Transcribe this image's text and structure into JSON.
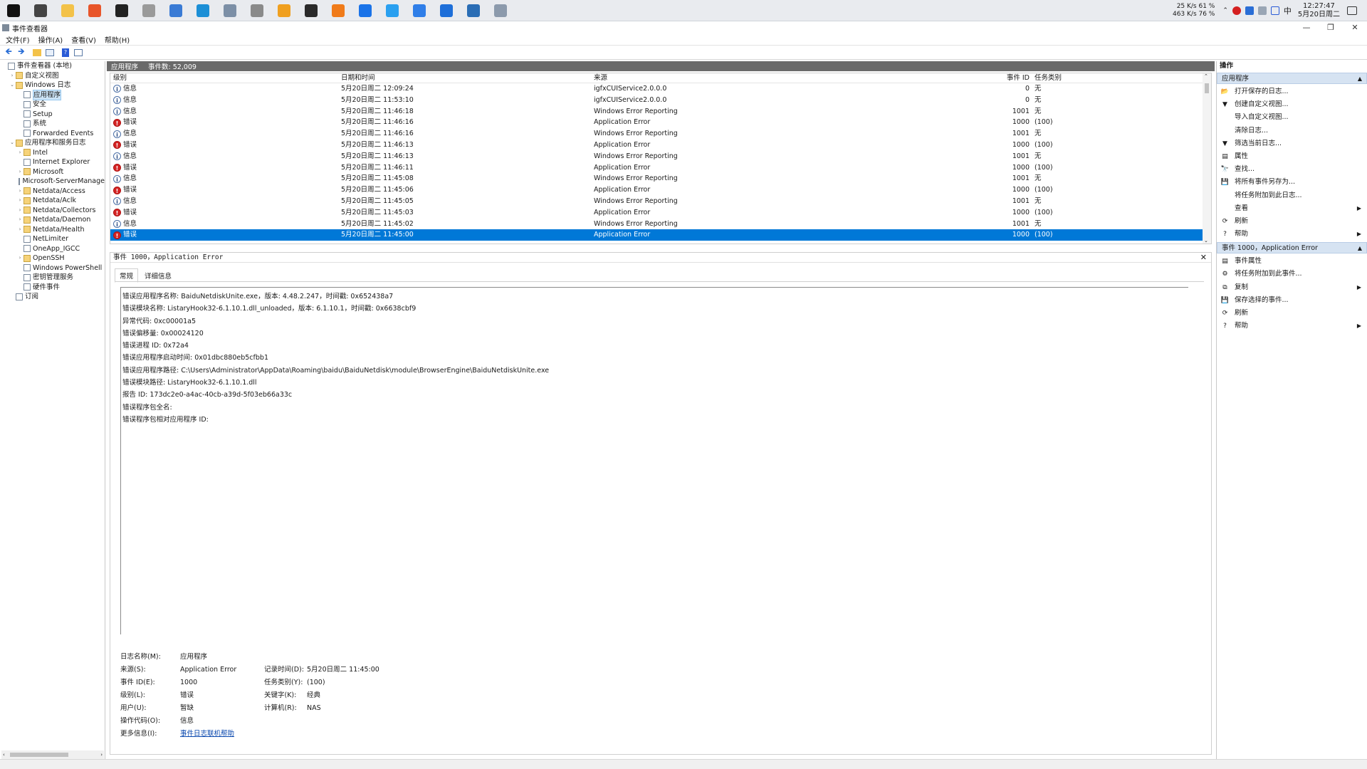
{
  "taskbar": {
    "apps": [
      {
        "name": "windows-start-icon",
        "color": "#111111"
      },
      {
        "name": "task-view-icon",
        "color": "#444444"
      },
      {
        "name": "file-explorer-icon",
        "color": "#f3c249"
      },
      {
        "name": "firefox-icon",
        "color": "#e8552a"
      },
      {
        "name": "terminal-icon",
        "color": "#222222"
      },
      {
        "name": "clock-app-icon",
        "color": "#9a9a9a"
      },
      {
        "name": "search-app-icon",
        "color": "#3a7bd5"
      },
      {
        "name": "store-icon",
        "color": "#1c8fd6"
      },
      {
        "name": "remote-desktop-icon",
        "color": "#7c8fa6"
      },
      {
        "name": "disk-icon",
        "color": "#8a8a8a"
      },
      {
        "name": "magnifier-icon",
        "color": "#f0a020"
      },
      {
        "name": "black-app-icon",
        "color": "#2a2a2a"
      },
      {
        "name": "orange-app-icon",
        "color": "#f07b1a"
      },
      {
        "name": "blue-circle-icon",
        "color": "#1a73e8"
      },
      {
        "name": "cloud-app-icon",
        "color": "#2aa0f0"
      },
      {
        "name": "telegram-like-icon",
        "color": "#2f7ee8"
      },
      {
        "name": "window-app-icon",
        "color": "#1e6fd9"
      },
      {
        "name": "network-app-icon",
        "color": "#2a6db5"
      },
      {
        "name": "event-viewer-taskbar-icon",
        "color": "#8c9aac"
      }
    ],
    "net_up": "25 K/s  61 %",
    "net_down": "463 K/s  76 %",
    "ime": "中",
    "time": "12:27:47",
    "date": "5月20日周二"
  },
  "window": {
    "title": "事件查看器",
    "controls": [
      "—",
      "❐",
      "✕"
    ]
  },
  "menu": [
    "文件(F)",
    "操作(A)",
    "查看(V)",
    "帮助(H)"
  ],
  "tree": [
    {
      "label": "事件查看器 (本地)",
      "depth": 0,
      "exp": "",
      "ic": "log"
    },
    {
      "label": "自定义视图",
      "depth": 1,
      "exp": "›",
      "ic": "folder"
    },
    {
      "label": "Windows 日志",
      "depth": 1,
      "exp": "⌄",
      "ic": "folder"
    },
    {
      "label": "应用程序",
      "depth": 2,
      "exp": "",
      "ic": "log",
      "selected": true
    },
    {
      "label": "安全",
      "depth": 2,
      "exp": "",
      "ic": "log"
    },
    {
      "label": "Setup",
      "depth": 2,
      "exp": "",
      "ic": "log"
    },
    {
      "label": "系统",
      "depth": 2,
      "exp": "",
      "ic": "log"
    },
    {
      "label": "Forwarded Events",
      "depth": 2,
      "exp": "",
      "ic": "log"
    },
    {
      "label": "应用程序和服务日志",
      "depth": 1,
      "exp": "⌄",
      "ic": "folder"
    },
    {
      "label": "Intel",
      "depth": 2,
      "exp": "›",
      "ic": "folder"
    },
    {
      "label": "Internet Explorer",
      "depth": 2,
      "exp": "",
      "ic": "log"
    },
    {
      "label": "Microsoft",
      "depth": 2,
      "exp": "›",
      "ic": "folder"
    },
    {
      "label": "Microsoft-ServerManage",
      "depth": 2,
      "exp": "",
      "ic": "log"
    },
    {
      "label": "Netdata/Access",
      "depth": 2,
      "exp": "›",
      "ic": "folder"
    },
    {
      "label": "Netdata/Aclk",
      "depth": 2,
      "exp": "›",
      "ic": "folder"
    },
    {
      "label": "Netdata/Collectors",
      "depth": 2,
      "exp": "›",
      "ic": "folder"
    },
    {
      "label": "Netdata/Daemon",
      "depth": 2,
      "exp": "›",
      "ic": "folder"
    },
    {
      "label": "Netdata/Health",
      "depth": 2,
      "exp": "›",
      "ic": "folder"
    },
    {
      "label": "NetLimiter",
      "depth": 2,
      "exp": "",
      "ic": "log"
    },
    {
      "label": "OneApp_IGCC",
      "depth": 2,
      "exp": "",
      "ic": "log"
    },
    {
      "label": "OpenSSH",
      "depth": 2,
      "exp": "›",
      "ic": "folder"
    },
    {
      "label": "Windows PowerShell",
      "depth": 2,
      "exp": "",
      "ic": "log"
    },
    {
      "label": "密钥管理服务",
      "depth": 2,
      "exp": "",
      "ic": "log"
    },
    {
      "label": "硬件事件",
      "depth": 2,
      "exp": "",
      "ic": "log"
    },
    {
      "label": "订阅",
      "depth": 1,
      "exp": "",
      "ic": "log"
    }
  ],
  "center": {
    "log_name": "应用程序",
    "event_count": "事件数: 52,009"
  },
  "columns": {
    "level": "级别",
    "date": "日期和时间",
    "source": "来源",
    "id": "事件 ID",
    "task": "任务类别"
  },
  "events": [
    {
      "level": "信息",
      "type": "info",
      "date": "5月20日周二 12:09:24",
      "source": "igfxCUIService2.0.0.0",
      "id": "0",
      "task": "无"
    },
    {
      "level": "信息",
      "type": "info",
      "date": "5月20日周二 11:53:10",
      "source": "igfxCUIService2.0.0.0",
      "id": "0",
      "task": "无"
    },
    {
      "level": "信息",
      "type": "info",
      "date": "5月20日周二 11:46:18",
      "source": "Windows Error Reporting",
      "id": "1001",
      "task": "无"
    },
    {
      "level": "错误",
      "type": "err",
      "date": "5月20日周二 11:46:16",
      "source": "Application Error",
      "id": "1000",
      "task": "(100)"
    },
    {
      "level": "信息",
      "type": "info",
      "date": "5月20日周二 11:46:16",
      "source": "Windows Error Reporting",
      "id": "1001",
      "task": "无"
    },
    {
      "level": "错误",
      "type": "err",
      "date": "5月20日周二 11:46:13",
      "source": "Application Error",
      "id": "1000",
      "task": "(100)"
    },
    {
      "level": "信息",
      "type": "info",
      "date": "5月20日周二 11:46:13",
      "source": "Windows Error Reporting",
      "id": "1001",
      "task": "无"
    },
    {
      "level": "错误",
      "type": "err",
      "date": "5月20日周二 11:46:11",
      "source": "Application Error",
      "id": "1000",
      "task": "(100)"
    },
    {
      "level": "信息",
      "type": "info",
      "date": "5月20日周二 11:45:08",
      "source": "Windows Error Reporting",
      "id": "1001",
      "task": "无"
    },
    {
      "level": "错误",
      "type": "err",
      "date": "5月20日周二 11:45:06",
      "source": "Application Error",
      "id": "1000",
      "task": "(100)"
    },
    {
      "level": "信息",
      "type": "info",
      "date": "5月20日周二 11:45:05",
      "source": "Windows Error Reporting",
      "id": "1001",
      "task": "无"
    },
    {
      "level": "错误",
      "type": "err",
      "date": "5月20日周二 11:45:03",
      "source": "Application Error",
      "id": "1000",
      "task": "(100)"
    },
    {
      "level": "信息",
      "type": "info",
      "date": "5月20日周二 11:45:02",
      "source": "Windows Error Reporting",
      "id": "1001",
      "task": "无"
    },
    {
      "level": "错误",
      "type": "err",
      "date": "5月20日周二 11:45:00",
      "source": "Application Error",
      "id": "1000",
      "task": "(100)",
      "selected": true
    }
  ],
  "detail": {
    "title": "事件 1000，Application Error",
    "close": "✕",
    "tabs": [
      "常规",
      "详细信息"
    ],
    "description": [
      "错误应用程序名称: BaiduNetdiskUnite.exe，版本: 4.48.2.247，时间戳: 0x652438a7",
      "错误模块名称: ListaryHook32-6.1.10.1.dll_unloaded，版本: 6.1.10.1，时间戳: 0x6638cbf9",
      "异常代码: 0xc00001a5",
      "错误偏移量: 0x00024120",
      "错误进程 ID: 0x72a4",
      "错误应用程序启动时间: 0x01dbc880eb5cfbb1",
      "错误应用程序路径: C:\\Users\\Administrator\\AppData\\Roaming\\baidu\\BaiduNetdisk\\module\\BrowserEngine\\BaiduNetdiskUnite.exe",
      "错误模块路径: ListaryHook32-6.1.10.1.dll",
      "报告 ID: 173dc2e0-a4ac-40cb-a39d-5f03eb66a33c",
      "错误程序包全名:",
      "错误程序包相对应用程序 ID:"
    ],
    "props": {
      "log_name_k": "日志名称(M):",
      "log_name_v": "应用程序",
      "source_k": "来源(S):",
      "source_v": "Application Error",
      "recorded_k": "记录时间(D):",
      "recorded_v": "5月20日周二 11:45:00",
      "event_id_k": "事件 ID(E):",
      "event_id_v": "1000",
      "task_k": "任务类别(Y):",
      "task_v": "(100)",
      "level_k": "级别(L):",
      "level_v": "错误",
      "keywords_k": "关键字(K):",
      "keywords_v": "经典",
      "user_k": "用户(U):",
      "user_v": "暂缺",
      "computer_k": "计算机(R):",
      "computer_v": "NAS",
      "opcode_k": "操作代码(O):",
      "opcode_v": "信息",
      "more_k": "更多信息(I):",
      "more_v": "事件日志联机帮助"
    }
  },
  "actions": {
    "title": "操作",
    "section1": "应用程序",
    "items1": [
      {
        "label": "打开保存的日志...",
        "icon": "open-folder-icon",
        "glyph": "📂",
        "sub": false
      },
      {
        "label": "创建自定义视图...",
        "icon": "filter-create-icon",
        "glyph": "▼",
        "sub": false
      },
      {
        "label": "导入自定义视图...",
        "icon": "",
        "glyph": "",
        "sub": false
      },
      {
        "label": "清除日志...",
        "icon": "",
        "glyph": "",
        "sub": false
      },
      {
        "label": "筛选当前日志...",
        "icon": "filter-icon",
        "glyph": "▼",
        "sub": false
      },
      {
        "label": "属性",
        "icon": "properties-icon",
        "glyph": "▤",
        "sub": false
      },
      {
        "label": "查找...",
        "icon": "find-icon",
        "glyph": "🔭",
        "sub": false
      },
      {
        "label": "将所有事件另存为...",
        "icon": "save-icon",
        "glyph": "💾",
        "sub": false
      },
      {
        "label": "将任务附加到此日志...",
        "icon": "",
        "glyph": "",
        "sub": false
      },
      {
        "label": "查看",
        "icon": "",
        "glyph": "",
        "sub": true
      },
      {
        "label": "刷新",
        "icon": "refresh-icon",
        "glyph": "⟳",
        "sub": false
      },
      {
        "label": "帮助",
        "icon": "help-icon",
        "glyph": "?",
        "sub": true
      }
    ],
    "section2": "事件 1000，Application Error",
    "items2": [
      {
        "label": "事件属性",
        "icon": "event-properties-icon",
        "glyph": "▤",
        "sub": false
      },
      {
        "label": "将任务附加到此事件...",
        "icon": "attach-task-icon",
        "glyph": "⚙",
        "sub": false
      },
      {
        "label": "复制",
        "icon": "copy-icon",
        "glyph": "⧉",
        "sub": true
      },
      {
        "label": "保存选择的事件...",
        "icon": "save-icon",
        "glyph": "💾",
        "sub": false
      },
      {
        "label": "刷新",
        "icon": "refresh-icon",
        "glyph": "⟳",
        "sub": false
      },
      {
        "label": "帮助",
        "icon": "help-icon",
        "glyph": "?",
        "sub": true
      }
    ]
  }
}
